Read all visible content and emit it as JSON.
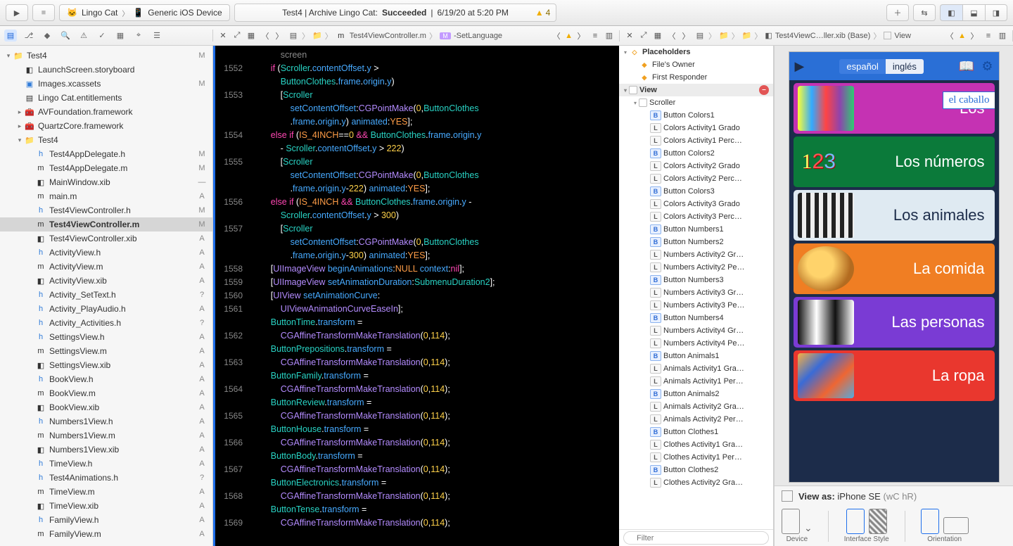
{
  "toolbar": {
    "scheme": "Lingo Cat",
    "destination": "Generic iOS Device",
    "status_prefix": "Test4 | Archive Lingo Cat:",
    "status_result": "Succeeded",
    "status_time": "6/19/20 at 5:20 PM",
    "warning_count": "4"
  },
  "jumpbar": {
    "file": "Test4ViewController.m",
    "method": "-SetLanguage"
  },
  "ib_jumpbar": {
    "file": "Test4ViewC…ller.xib (Base)",
    "item": "View"
  },
  "navigator": [
    {
      "d": 0,
      "disc": "▾",
      "icon": "📁",
      "iconCls": "fblue",
      "name": "Test4",
      "stat": "M"
    },
    {
      "d": 1,
      "disc": "",
      "icon": "◧",
      "iconCls": "",
      "name": "LaunchScreen.storyboard",
      "stat": ""
    },
    {
      "d": 1,
      "disc": "",
      "icon": "▣",
      "iconCls": "fblue",
      "name": "Images.xcassets",
      "stat": "M"
    },
    {
      "d": 1,
      "disc": "",
      "icon": "▤",
      "iconCls": "",
      "name": "Lingo Cat.entitlements",
      "stat": ""
    },
    {
      "d": 1,
      "disc": "▸",
      "icon": "🧰",
      "iconCls": "",
      "name": "AVFoundation.framework",
      "stat": ""
    },
    {
      "d": 1,
      "disc": "▸",
      "icon": "🧰",
      "iconCls": "",
      "name": "QuartzCore.framework",
      "stat": ""
    },
    {
      "d": 1,
      "disc": "▾",
      "icon": "📁",
      "iconCls": "fblue",
      "name": "Test4",
      "stat": ""
    },
    {
      "d": 2,
      "disc": "",
      "icon": "h",
      "iconCls": "fh",
      "name": "Test4AppDelegate.h",
      "stat": "M"
    },
    {
      "d": 2,
      "disc": "",
      "icon": "m",
      "iconCls": "fm",
      "name": "Test4AppDelegate.m",
      "stat": "M"
    },
    {
      "d": 2,
      "disc": "",
      "icon": "◧",
      "iconCls": "",
      "name": "MainWindow.xib",
      "stat": "—"
    },
    {
      "d": 2,
      "disc": "",
      "icon": "m",
      "iconCls": "fm",
      "name": "main.m",
      "stat": "A"
    },
    {
      "d": 2,
      "disc": "",
      "icon": "h",
      "iconCls": "fh",
      "name": "Test4ViewController.h",
      "stat": "M"
    },
    {
      "d": 2,
      "disc": "",
      "icon": "m",
      "iconCls": "fm",
      "name": "Test4ViewController.m",
      "stat": "M",
      "sel": true
    },
    {
      "d": 2,
      "disc": "",
      "icon": "◧",
      "iconCls": "",
      "name": "Test4ViewController.xib",
      "stat": "A"
    },
    {
      "d": 2,
      "disc": "",
      "icon": "h",
      "iconCls": "fh",
      "name": "ActivityView.h",
      "stat": "A"
    },
    {
      "d": 2,
      "disc": "",
      "icon": "m",
      "iconCls": "fm",
      "name": "ActivityView.m",
      "stat": "A"
    },
    {
      "d": 2,
      "disc": "",
      "icon": "◧",
      "iconCls": "",
      "name": "ActivityView.xib",
      "stat": "A"
    },
    {
      "d": 2,
      "disc": "",
      "icon": "h",
      "iconCls": "fh",
      "name": "Activity_SetText.h",
      "stat": "?"
    },
    {
      "d": 2,
      "disc": "",
      "icon": "h",
      "iconCls": "fh",
      "name": "Activity_PlayAudio.h",
      "stat": "A"
    },
    {
      "d": 2,
      "disc": "",
      "icon": "h",
      "iconCls": "fh",
      "name": "Activity_Activities.h",
      "stat": "?"
    },
    {
      "d": 2,
      "disc": "",
      "icon": "h",
      "iconCls": "fh",
      "name": "SettingsView.h",
      "stat": "A"
    },
    {
      "d": 2,
      "disc": "",
      "icon": "m",
      "iconCls": "fm",
      "name": "SettingsView.m",
      "stat": "A"
    },
    {
      "d": 2,
      "disc": "",
      "icon": "◧",
      "iconCls": "",
      "name": "SettingsView.xib",
      "stat": "A"
    },
    {
      "d": 2,
      "disc": "",
      "icon": "h",
      "iconCls": "fh",
      "name": "BookView.h",
      "stat": "A"
    },
    {
      "d": 2,
      "disc": "",
      "icon": "m",
      "iconCls": "fm",
      "name": "BookView.m",
      "stat": "A"
    },
    {
      "d": 2,
      "disc": "",
      "icon": "◧",
      "iconCls": "",
      "name": "BookView.xib",
      "stat": "A"
    },
    {
      "d": 2,
      "disc": "",
      "icon": "h",
      "iconCls": "fh",
      "name": "Numbers1View.h",
      "stat": "A"
    },
    {
      "d": 2,
      "disc": "",
      "icon": "m",
      "iconCls": "fm",
      "name": "Numbers1View.m",
      "stat": "A"
    },
    {
      "d": 2,
      "disc": "",
      "icon": "◧",
      "iconCls": "",
      "name": "Numbers1View.xib",
      "stat": "A"
    },
    {
      "d": 2,
      "disc": "",
      "icon": "h",
      "iconCls": "fh",
      "name": "TimeView.h",
      "stat": "A"
    },
    {
      "d": 2,
      "disc": "",
      "icon": "h",
      "iconCls": "fh",
      "name": "Test4Animations.h",
      "stat": "?"
    },
    {
      "d": 2,
      "disc": "",
      "icon": "m",
      "iconCls": "fm",
      "name": "TimeView.m",
      "stat": "A"
    },
    {
      "d": 2,
      "disc": "",
      "icon": "◧",
      "iconCls": "",
      "name": "TimeView.xib",
      "stat": "A"
    },
    {
      "d": 2,
      "disc": "",
      "icon": "h",
      "iconCls": "fh",
      "name": "FamilyView.h",
      "stat": "A"
    },
    {
      "d": 2,
      "disc": "",
      "icon": "m",
      "iconCls": "fm",
      "name": "FamilyView.m",
      "stat": "A"
    }
  ],
  "gutter": [
    "",
    "1552",
    "",
    "1553",
    "",
    "",
    "1554",
    "",
    "1555",
    "",
    "",
    "1556",
    "",
    "1557",
    "",
    "",
    "1558",
    "1559",
    "1560",
    "1561",
    "",
    "1562",
    "",
    "1563",
    "",
    "1564",
    "",
    "1565",
    "",
    "1566",
    "",
    "1567",
    "",
    "1568",
    "",
    "1569",
    ""
  ],
  "code_lines": [
    "            <span class='cmt'>screen</span>",
    "        <span class='kw'>if</span> (<span class='id'>Scroller</span>.<span class='prop'>contentOffset</span>.<span class='prop'>y</span> &gt;",
    "            <span class='id'>ButtonClothes</span>.<span class='prop'>frame</span>.<span class='prop'>origin</span>.<span class='prop'>y</span>)",
    "            [<span class='id'>Scroller</span>",
    "                <span class='prop'>setContentOffset</span>:<span class='cls'>CGPointMake</span>(<span class='num'>0</span>,<span class='id'>ButtonClothes</span>",
    "                .<span class='prop'>frame</span>.<span class='prop'>origin</span>.<span class='prop'>y</span>) <span class='prop'>animated</span>:<span class='mac'>YES</span>];",
    "        <span class='kw'>else if</span> (<span class='mac'>IS_4INCH</span>==<span class='num'>0</span> <span class='kw'>&amp;&amp;</span> <span class='id'>ButtonClothes</span>.<span class='prop'>frame</span>.<span class='prop'>origin</span>.<span class='prop'>y</span>",
    "            - <span class='id'>Scroller</span>.<span class='prop'>contentOffset</span>.<span class='prop'>y</span> &gt; <span class='num'>222</span>)",
    "            [<span class='id'>Scroller</span>",
    "                <span class='prop'>setContentOffset</span>:<span class='cls'>CGPointMake</span>(<span class='num'>0</span>,<span class='id'>ButtonClothes</span>",
    "                .<span class='prop'>frame</span>.<span class='prop'>origin</span>.<span class='prop'>y</span>-<span class='num'>222</span>) <span class='prop'>animated</span>:<span class='mac'>YES</span>];",
    "        <span class='kw'>else if</span> (<span class='mac'>IS_4INCH</span> <span class='kw'>&amp;&amp;</span> <span class='id'>ButtonClothes</span>.<span class='prop'>frame</span>.<span class='prop'>origin</span>.<span class='prop'>y</span> -",
    "            <span class='id'>Scroller</span>.<span class='prop'>contentOffset</span>.<span class='prop'>y</span> &gt; <span class='num'>300</span>)",
    "            [<span class='id'>Scroller</span>",
    "                <span class='prop'>setContentOffset</span>:<span class='cls'>CGPointMake</span>(<span class='num'>0</span>,<span class='id'>ButtonClothes</span>",
    "                .<span class='prop'>frame</span>.<span class='prop'>origin</span>.<span class='prop'>y</span>-<span class='num'>300</span>) <span class='prop'>animated</span>:<span class='mac'>YES</span>];",
    "",
    "        [<span class='cls'>UIImageView</span> <span class='prop'>beginAnimations</span>:<span class='mac'>NULL</span> <span class='prop'>context</span>:<span class='kw'>nil</span>];",
    "        [<span class='cls'>UIImageView</span> <span class='prop'>setAnimationDuration</span>:<span class='id'>SubmenuDuration2</span>];",
    "        [<span class='cls'>UIView</span> <span class='prop'>setAnimationCurve</span>:",
    "            <span class='cls'>UIViewAnimationCurveEaseIn</span>];",
    "        <span class='id'>ButtonTime</span>.<span class='prop'>transform</span> =",
    "            <span class='cls'>CGAffineTransformMakeTranslation</span>(<span class='num'>0</span>,<span class='num'>114</span>);",
    "        <span class='id'>ButtonPrepositions</span>.<span class='prop'>transform</span> =",
    "            <span class='cls'>CGAffineTransformMakeTranslation</span>(<span class='num'>0</span>,<span class='num'>114</span>);",
    "        <span class='id'>ButtonFamily</span>.<span class='prop'>transform</span> =",
    "            <span class='cls'>CGAffineTransformMakeTranslation</span>(<span class='num'>0</span>,<span class='num'>114</span>);",
    "        <span class='id'>ButtonReview</span>.<span class='prop'>transform</span> =",
    "            <span class='cls'>CGAffineTransformMakeTranslation</span>(<span class='num'>0</span>,<span class='num'>114</span>);",
    "        <span class='id'>ButtonHouse</span>.<span class='prop'>transform</span> =",
    "            <span class='cls'>CGAffineTransformMakeTranslation</span>(<span class='num'>0</span>,<span class='num'>114</span>);",
    "        <span class='id'>ButtonBody</span>.<span class='prop'>transform</span> =",
    "            <span class='cls'>CGAffineTransformMakeTranslation</span>(<span class='num'>0</span>,<span class='num'>114</span>);",
    "        <span class='id'>ButtonElectronics</span>.<span class='prop'>transform</span> =",
    "            <span class='cls'>CGAffineTransformMakeTranslation</span>(<span class='num'>0</span>,<span class='num'>114</span>);",
    "        <span class='id'>ButtonTense</span>.<span class='prop'>transform</span> =",
    "            <span class='cls'>CGAffineTransformMakeTranslation</span>(<span class='num'>0</span>,<span class='num'>114</span>);"
  ],
  "outline": {
    "placeholders_header": "Placeholders",
    "placeholders": [
      "File's Owner",
      "First Responder"
    ],
    "view_header": "View",
    "scroller": "Scroller",
    "items": [
      {
        "t": "B",
        "n": "Button Colors1"
      },
      {
        "t": "L",
        "n": "Colors Activity1 Grado"
      },
      {
        "t": "L",
        "n": "Colors Activity1 Perc…"
      },
      {
        "t": "B",
        "n": "Button Colors2"
      },
      {
        "t": "L",
        "n": "Colors Activity2 Grado"
      },
      {
        "t": "L",
        "n": "Colors Activity2 Perc…"
      },
      {
        "t": "B",
        "n": "Button Colors3"
      },
      {
        "t": "L",
        "n": "Colors Activity3 Grado"
      },
      {
        "t": "L",
        "n": "Colors Activity3 Perc…"
      },
      {
        "t": "B",
        "n": "Button Numbers1"
      },
      {
        "t": "B",
        "n": "Button Numbers2"
      },
      {
        "t": "L",
        "n": "Numbers Activity2 Gr…"
      },
      {
        "t": "L",
        "n": "Numbers Activity2 Pe…"
      },
      {
        "t": "B",
        "n": "Button Numbers3"
      },
      {
        "t": "L",
        "n": "Numbers Activity3 Gr…"
      },
      {
        "t": "L",
        "n": "Numbers Activity3 Pe…"
      },
      {
        "t": "B",
        "n": "Button Numbers4"
      },
      {
        "t": "L",
        "n": "Numbers Activity4 Gr…"
      },
      {
        "t": "L",
        "n": "Numbers Activity4 Pe…"
      },
      {
        "t": "B",
        "n": "Button Animals1"
      },
      {
        "t": "L",
        "n": "Animals Activity1 Gra…"
      },
      {
        "t": "L",
        "n": "Animals Activity1 Per…"
      },
      {
        "t": "B",
        "n": "Button Animals2"
      },
      {
        "t": "L",
        "n": "Animals Activity2 Gra…"
      },
      {
        "t": "L",
        "n": "Animals Activity2 Per…"
      },
      {
        "t": "B",
        "n": "Button Clothes1"
      },
      {
        "t": "L",
        "n": "Clothes Activity1 Gra…"
      },
      {
        "t": "L",
        "n": "Clothes Activity1 Per…"
      },
      {
        "t": "B",
        "n": "Button Clothes2"
      },
      {
        "t": "L",
        "n": "Clothes Activity2 Gra…"
      }
    ]
  },
  "filter_placeholder": "Filter",
  "canvas": {
    "lang_es": "español",
    "lang_en": "inglés",
    "hover_tag": "el caballo",
    "cards": [
      "Los",
      "Los números",
      "Los animales",
      "La comida",
      "Las personas",
      "La ropa"
    ]
  },
  "viewas": {
    "label": "View as:",
    "device": "iPhone SE",
    "suffix": "(wC hR)",
    "groups": [
      "Device",
      "Interface Style",
      "Orientation"
    ]
  }
}
